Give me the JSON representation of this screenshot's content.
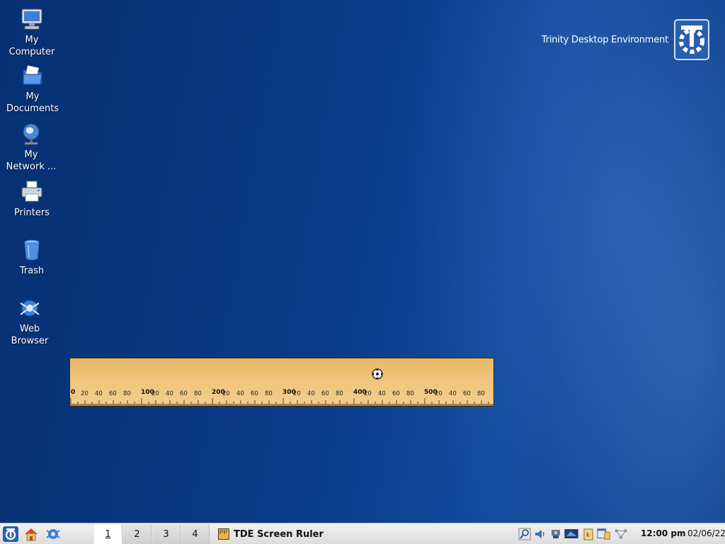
{
  "desktop": {
    "icons": [
      {
        "name": "my-computer",
        "line1": "My",
        "line2": "Computer"
      },
      {
        "name": "my-documents",
        "line1": "My",
        "line2": "Documents"
      },
      {
        "name": "my-network",
        "line1": "My",
        "line2": "Network ..."
      },
      {
        "name": "printers",
        "line1": "Printers",
        "line2": ""
      },
      {
        "name": "trash",
        "line1": "Trash",
        "line2": ""
      },
      {
        "name": "web-browser",
        "line1": "Web",
        "line2": "Browser"
      }
    ],
    "brand_text": "Trinity Desktop Environment"
  },
  "ruler": {
    "major_labels": [
      "0",
      "100",
      "200",
      "300",
      "400",
      "500"
    ],
    "minor_labels": [
      "20",
      "40",
      "60",
      "80"
    ],
    "color": "#f0c57c"
  },
  "taskbar": {
    "desktops": [
      "1",
      "2",
      "3",
      "4"
    ],
    "active_desktop": "1",
    "task_title": "TDE Screen Ruler",
    "clock_time": "12:00 pm",
    "clock_date": "02/06/22",
    "tray_icons": [
      "search-icon",
      "volume-icon",
      "network-icon",
      "display-icon",
      "klipper-icon",
      "window-list-icon",
      "wifi-icon"
    ]
  },
  "colors": {
    "desktop_blue": "#0a3a86",
    "taskbar_bg": "#e6e6e6",
    "ruler_tan": "#f0c57c"
  }
}
